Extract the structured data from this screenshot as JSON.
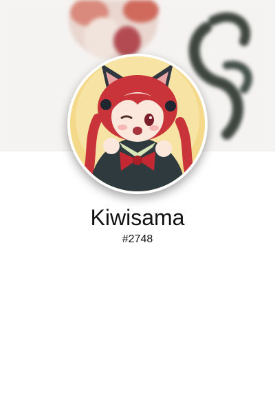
{
  "profile": {
    "username": "Kiwisama",
    "discriminator": "#2748",
    "avatar_icon": "anime-girl-avatar",
    "banner_icon": "blurred-banner-image"
  },
  "colors": {
    "background": "#ffffff",
    "banner": "#f4f2f1",
    "avatar_background": "#f3d98c",
    "hair": "#c8343a",
    "text": "#111111"
  }
}
